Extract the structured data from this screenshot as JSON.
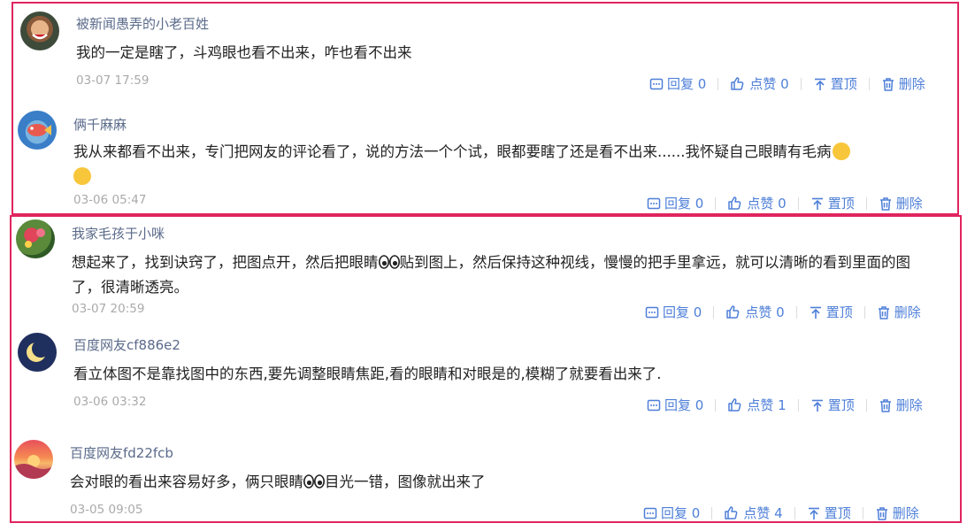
{
  "colors": {
    "frame": "#e0245e",
    "action": "#4e7fd8",
    "username": "#5a6a8a",
    "time": "#aaaaaa"
  },
  "actions": {
    "reply": "回复",
    "like": "点赞",
    "top": "置顶",
    "delete": "删除"
  },
  "comments": [
    {
      "user": "被新闻愚弄的小老百姓",
      "text": "我的一定是瞎了，斗鸡眼也看不出来，咋也看不出来",
      "time": "03-07 17:59",
      "reply_count": "0",
      "like_count": "0",
      "avatar": "person-laughing-avatar"
    },
    {
      "user": "俩千麻麻",
      "text": "我从来都看不出来，专门把网友的评论看了，说的方法一个个试，眼都要瞎了还是看不出来......我怀疑自己眼睛有毛病",
      "time": "03-06 05:47",
      "reply_count": "0",
      "like_count": "0",
      "avatar": "fish-avatar"
    },
    {
      "user": "我家毛孩于小咪",
      "text_a": "想起来了，找到诀窍了，把图点开，然后把眼睛",
      "text_b": "贴到图上，然后保持这种视线，慢慢的把手里拿远，就可以清晰的看到里面的图了，很清晰透亮。",
      "time": "03-07 20:59",
      "reply_count": "0",
      "like_count": "0",
      "avatar": "flowers-avatar"
    },
    {
      "user": "百度网友cf886e2",
      "text": "看立体图不是靠找图中的东西,要先调整眼睛焦距,看的眼睛和对眼是的,模糊了就要看出来了.",
      "time": "03-06 03:32",
      "reply_count": "0",
      "like_count": "1",
      "avatar": "moon-avatar"
    },
    {
      "user": "百度网友fd22fcb",
      "text_a": "会对眼的看出来容易好多，俩只眼睛",
      "text_b": "目光一错，图像就出来了",
      "time": "03-05 09:05",
      "reply_count": "0",
      "like_count": "4",
      "avatar": "sunset-avatar"
    }
  ]
}
